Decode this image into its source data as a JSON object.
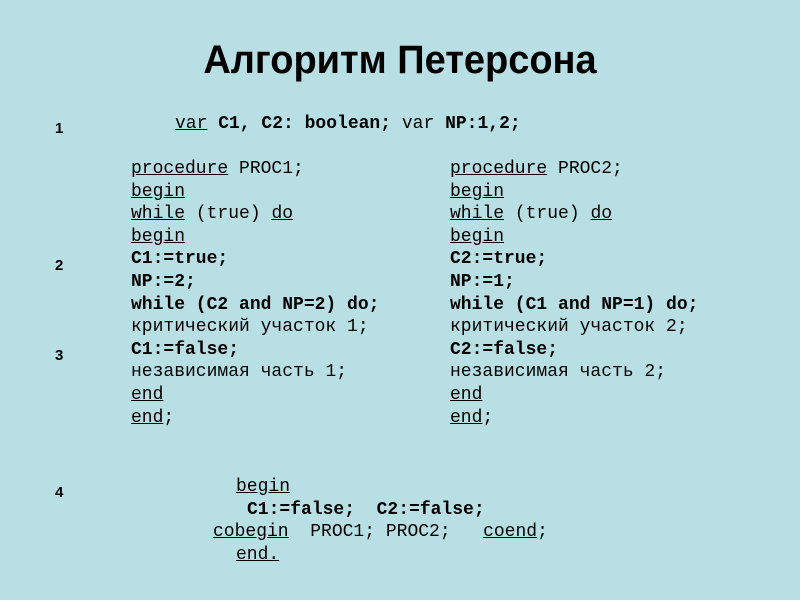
{
  "slide": {
    "title": "Алгоритм Петерсона",
    "step_numbers": [
      "1",
      "2",
      "3",
      "4"
    ],
    "declaration": {
      "kw1": "var",
      "part1": " C1, C2: boolean;",
      "kw2": " var",
      "part2": " NP:1,2;"
    },
    "proc1": {
      "l1_kw": "procedure",
      "l1_rest": " PROC1;",
      "l2_kw": "begin",
      "l3_kw1": "while",
      "l3_mid": " (true) ",
      "l3_kw2": "do",
      "l4_kw": "begin",
      "l5": "C1:=true;",
      "l6": "NP:=2;",
      "l7": "while (C2 and NP=2) do;",
      "l8": "критический участок 1;",
      "l9": "C1:=false;",
      "l10": "независимая часть 1;",
      "l11_kw": "end",
      "l12_kw": "end",
      "l12_rest": ";"
    },
    "proc2": {
      "l1_kw": "procedure",
      "l1_rest": " PROC2;",
      "l2_kw": "begin",
      "l3_kw1": "while",
      "l3_mid": " (true) ",
      "l3_kw2": "do",
      "l4_kw": "begin",
      "l5": "C2:=true;",
      "l6": "NP:=1;",
      "l7": "while (C1 and NP=1) do;",
      "l8": "критический участок 2;",
      "l9": "C2:=false;",
      "l10": "независимая часть 2;",
      "l11_kw": "end",
      "l12_kw": "end",
      "l12_rest": ";"
    },
    "main": {
      "l1_kw": "begin",
      "l2": "C1:=false;  C2:=false;",
      "l3_kw1": "cobegin",
      "l3_mid": "  PROC1; PROC2;   ",
      "l3_kw2": "coend",
      "l3_rest": ";",
      "l4_kw": "end."
    }
  }
}
